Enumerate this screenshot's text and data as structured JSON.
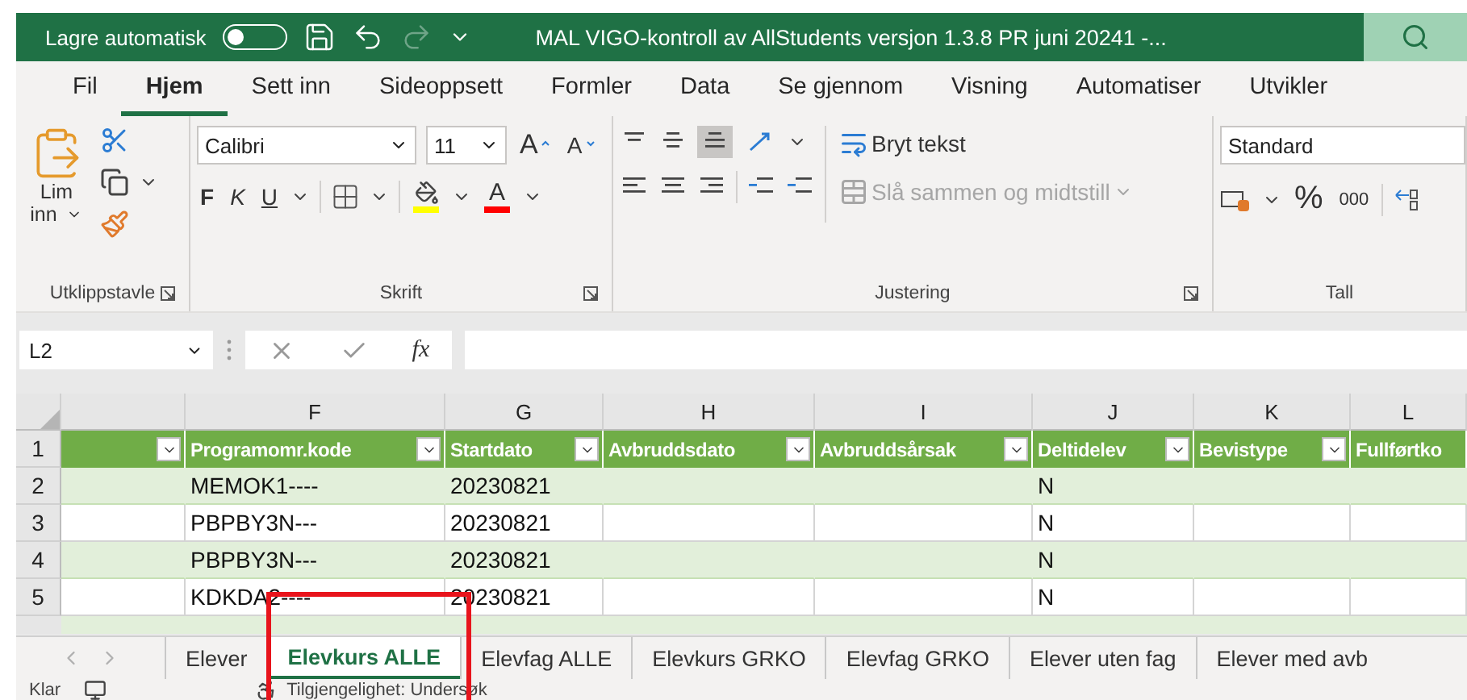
{
  "title_bar": {
    "autosave_label": "Lagre automatisk",
    "autosave_on": false,
    "title": "MAL VIGO-kontroll av AllStudents versjon 1.3.8 PR juni 20241  -..."
  },
  "menu_tabs": [
    {
      "label": "Fil",
      "selected": false
    },
    {
      "label": "Hjem",
      "selected": true
    },
    {
      "label": "Sett inn",
      "selected": false
    },
    {
      "label": "Sideoppsett",
      "selected": false
    },
    {
      "label": "Formler",
      "selected": false
    },
    {
      "label": "Data",
      "selected": false
    },
    {
      "label": "Se gjennom",
      "selected": false
    },
    {
      "label": "Visning",
      "selected": false
    },
    {
      "label": "Automatiser",
      "selected": false
    },
    {
      "label": "Utvikler",
      "selected": false
    }
  ],
  "ribbon": {
    "clipboard": {
      "paste_label": "Lim",
      "paste_label_2": "inn",
      "group_label": "Utklippstavle"
    },
    "font": {
      "font_name": "Calibri",
      "font_size": "11",
      "grow": "A",
      "shrink": "A",
      "bold": "F",
      "italic": "K",
      "underline": "U",
      "font_color": "A",
      "group_label": "Skrift"
    },
    "alignment": {
      "wrap_text": "Bryt tekst",
      "merge": "Slå sammen og midtstill",
      "merge_disabled": true,
      "group_label": "Justering"
    },
    "number": {
      "format": "Standard",
      "percent": "%",
      "thousands": "000",
      "group_label": "Tall"
    }
  },
  "formula_bar": {
    "name_box": "L2",
    "fx": "fx"
  },
  "sheet": {
    "columns": [
      "F",
      "G",
      "H",
      "I",
      "J",
      "K",
      "L"
    ],
    "headers": [
      "Programomr.kode",
      "Startdato",
      "Avbruddsdato",
      "Avbruddsårsak",
      "Deltidelev",
      "Bevistype",
      "Fullførtko"
    ],
    "header_row_number": "1",
    "rows": [
      {
        "number": "2",
        "program": "MEMOK1----",
        "start": "20230821",
        "deltid": "N"
      },
      {
        "number": "3",
        "program": "PBPBY3N---",
        "start": "20230821",
        "deltid": "N"
      },
      {
        "number": "4",
        "program": "PBPBY3N---",
        "start": "20230821",
        "deltid": "N"
      },
      {
        "number": "5",
        "program": "KDKDA2----",
        "start": "20230821",
        "deltid": "N"
      }
    ]
  },
  "sheet_tabs": [
    {
      "label": "Elever",
      "selected": false
    },
    {
      "label": "Elevkurs ALLE",
      "selected": true
    },
    {
      "label": "Elevfag ALLE",
      "selected": false
    },
    {
      "label": "Elevkurs GRKO",
      "selected": false
    },
    {
      "label": "Elevfag GRKO",
      "selected": false
    },
    {
      "label": "Elever uten fag",
      "selected": false
    },
    {
      "label": "Elever med avb",
      "selected": false
    }
  ],
  "status_bar": {
    "ready": "Klar",
    "accessibility": "Tilgjengelighet: Undersøk"
  }
}
